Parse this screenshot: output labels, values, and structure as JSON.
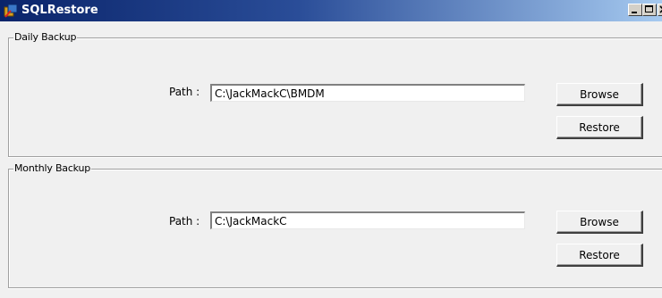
{
  "window": {
    "title": "SQLRestore",
    "icon": "app-icon"
  },
  "daily": {
    "group_label": "Daily Backup",
    "path_label": "Path :",
    "path_value": "C:\\JackMackC\\BMDM",
    "browse_label": "Browse",
    "restore_label": "Restore"
  },
  "monthly": {
    "group_label": "Monthly Backup",
    "path_label": "Path :",
    "path_value": "C:\\JackMackC",
    "browse_label": "Browse",
    "restore_label": "Restore"
  }
}
